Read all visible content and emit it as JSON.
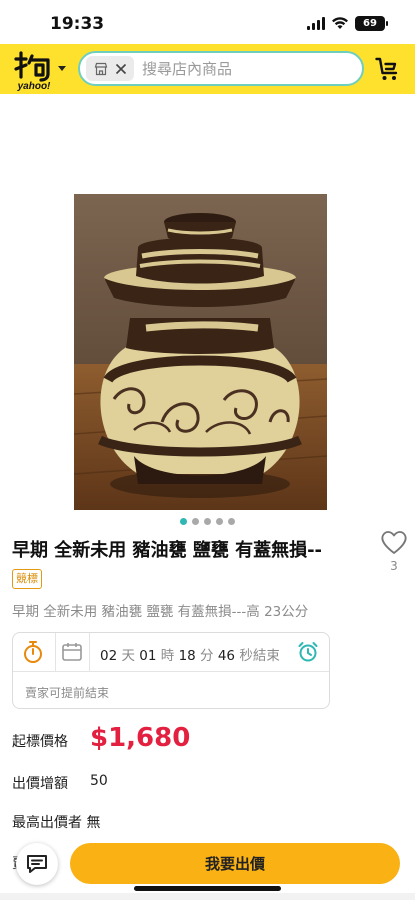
{
  "status_bar": {
    "time": "19:33",
    "battery": "69"
  },
  "header": {
    "logo_text": "yahoo!",
    "search": {
      "placeholder": "搜尋店內商品"
    }
  },
  "product": {
    "image_count": 5,
    "active_image_index": 0,
    "title": "早期 全新未用 豬油甕 鹽甕 有蓋無損--",
    "favorite_count": "3",
    "badge": "競標",
    "subtitle": "早期 全新未用 豬油甕 鹽甕 有蓋無損---高 23公分"
  },
  "countdown": {
    "days": "02",
    "days_unit": "天",
    "hours": "01",
    "hours_unit": "時",
    "minutes": "18",
    "minutes_unit": "分",
    "seconds": "46",
    "seconds_unit": "秒結束",
    "note": "賣家可提前結束"
  },
  "pricing": {
    "start_price_label": "起標價格",
    "start_price": "$1,680",
    "increment_label": "出價增額",
    "increment": "50",
    "highest_bidder_label": "最高出價者 無"
  },
  "bottom": {
    "partial_label": "賣",
    "bid_button": "我要出價"
  },
  "colors": {
    "header_bg": "#fde12c",
    "price_red": "#e3203f",
    "bid_button": "#f9b113",
    "dot_active": "#2eb7b3",
    "badge_orange": "#e39a12"
  }
}
